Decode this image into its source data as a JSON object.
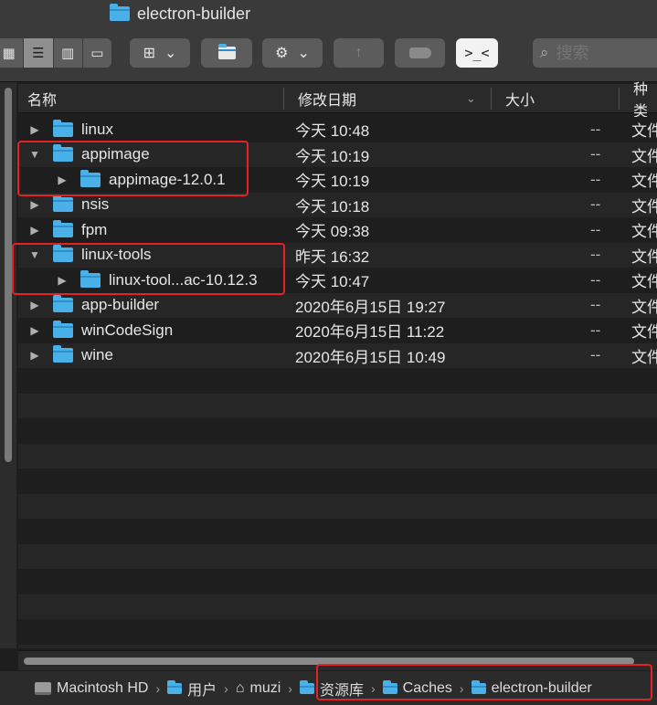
{
  "window": {
    "title": "electron-builder"
  },
  "toolbar": {
    "view_icon": "⊞",
    "view_caret": "⌄",
    "gear_icon": "⚙",
    "gear_caret": "⌄",
    "new_folder_icon": "+",
    "share_icon": "↑",
    "terminal_icon": ">_<",
    "search_placeholder": "搜索"
  },
  "columns": {
    "name": "名称",
    "date": "修改日期",
    "size": "大小",
    "kind": "种类"
  },
  "files": [
    {
      "name": "linux",
      "date": "今天 10:48",
      "size": "--",
      "kind": "文件",
      "expanded": false,
      "indent": 0
    },
    {
      "name": "appimage",
      "date": "今天 10:19",
      "size": "--",
      "kind": "文件",
      "expanded": true,
      "indent": 0
    },
    {
      "name": "appimage-12.0.1",
      "date": "今天 10:19",
      "size": "--",
      "kind": "文件",
      "expanded": false,
      "indent": 1
    },
    {
      "name": "nsis",
      "date": "今天 10:18",
      "size": "--",
      "kind": "文件",
      "expanded": false,
      "indent": 0
    },
    {
      "name": "fpm",
      "date": "今天 09:38",
      "size": "--",
      "kind": "文件",
      "expanded": false,
      "indent": 0
    },
    {
      "name": "linux-tools",
      "date": "昨天 16:32",
      "size": "--",
      "kind": "文件",
      "expanded": true,
      "indent": 0
    },
    {
      "name": "linux-tool...ac-10.12.3",
      "date": "今天 10:47",
      "size": "--",
      "kind": "文件",
      "expanded": false,
      "indent": 1
    },
    {
      "name": "app-builder",
      "date": "2020年6月15日 19:27",
      "size": "--",
      "kind": "文件",
      "expanded": false,
      "indent": 0
    },
    {
      "name": "winCodeSign",
      "date": "2020年6月15日 11:22",
      "size": "--",
      "kind": "文件",
      "expanded": false,
      "indent": 0
    },
    {
      "name": "wine",
      "date": "2020年6月15日 10:49",
      "size": "--",
      "kind": "文件",
      "expanded": false,
      "indent": 0
    }
  ],
  "path": [
    {
      "label": "Macintosh HD",
      "icon": "hard-drive-icon"
    },
    {
      "label": "用户",
      "icon": "folder-icon"
    },
    {
      "label": "muzi",
      "icon": "home-icon"
    },
    {
      "label": "资源库",
      "icon": "folder-icon"
    },
    {
      "label": "Caches",
      "icon": "folder-icon"
    },
    {
      "label": "electron-builder",
      "icon": "folder-icon"
    }
  ],
  "colors": {
    "highlight": "#e32127",
    "folder": "#4ab0e8"
  }
}
